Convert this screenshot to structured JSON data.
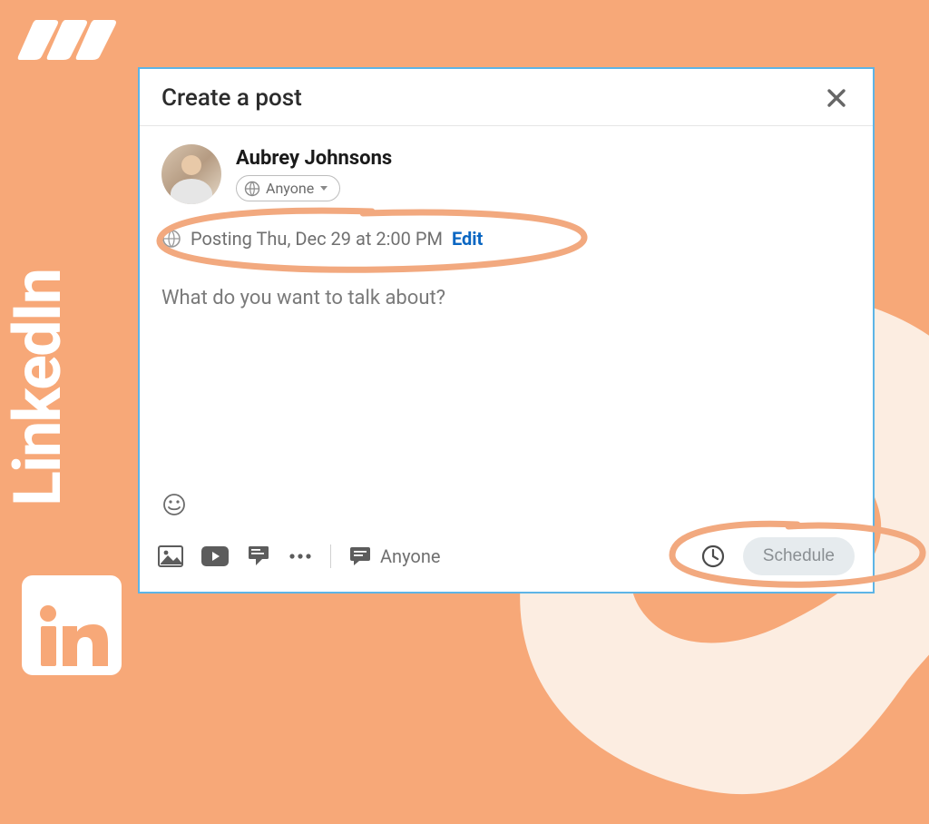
{
  "brand": {
    "side_label": "LinkedIn"
  },
  "modal": {
    "title": "Create a post",
    "author": {
      "name": "Aubrey Johnsons",
      "visibility_label": "Anyone"
    },
    "schedule": {
      "text": "Posting Thu, Dec 29 at 2:00 PM",
      "edit_label": "Edit"
    },
    "placeholder": "What do you want to talk about?",
    "comment_visibility": "Anyone",
    "schedule_button": "Schedule"
  },
  "colors": {
    "background": "#f7a878",
    "annotation": "#f2a97f",
    "modal_border": "#5db4e6",
    "link": "#0a66c2"
  }
}
